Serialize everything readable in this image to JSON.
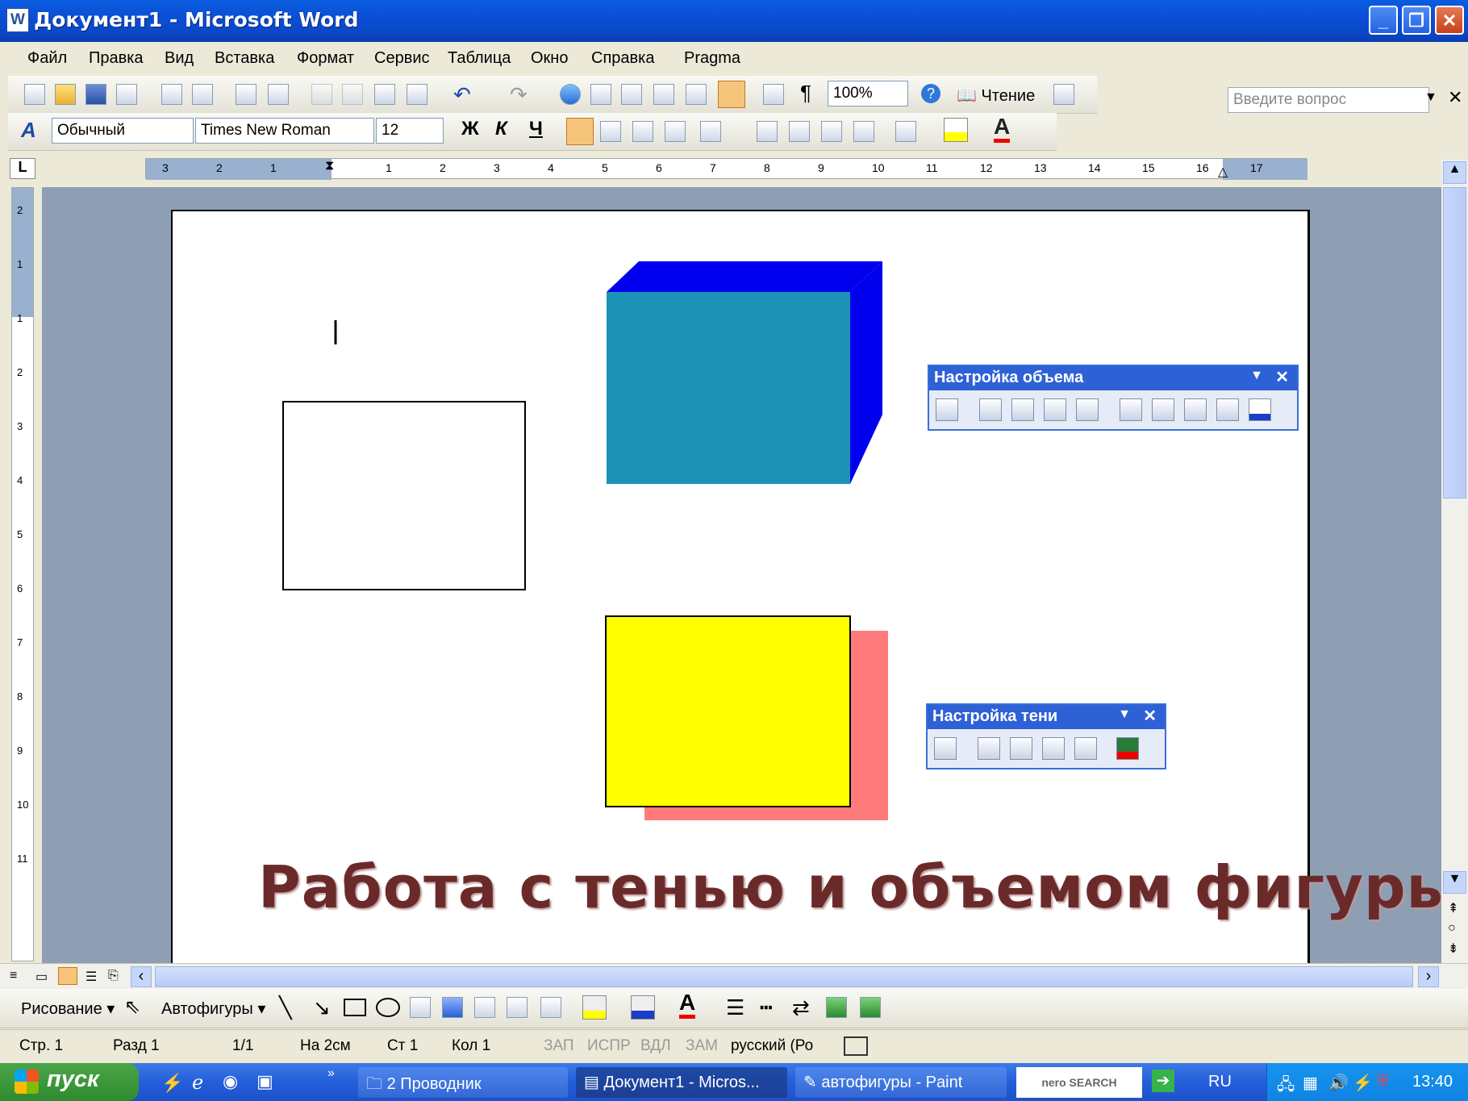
{
  "window": {
    "title": "Документ1 - Microsoft Word"
  },
  "menu": {
    "items": [
      "Файл",
      "Правка",
      "Вид",
      "Вставка",
      "Формат",
      "Сервис",
      "Таблица",
      "Окно",
      "Справка",
      "Pragma"
    ],
    "help_placeholder": "Введите вопрос"
  },
  "standard_toolbar": {
    "zoom": "100%",
    "reading_label": "Чтение"
  },
  "formatting_toolbar": {
    "style": "Обычный",
    "font": "Times New Roman",
    "size": "12",
    "bold": "Ж",
    "italic": "К",
    "underline": "Ч"
  },
  "ruler": {
    "labels": [
      "3",
      "2",
      "1",
      "1",
      "2",
      "3",
      "4",
      "5",
      "6",
      "7",
      "8",
      "9",
      "10",
      "11",
      "12",
      "13",
      "14",
      "15",
      "16",
      "17"
    ]
  },
  "vruler": {
    "labels": [
      "2",
      "1",
      "1",
      "2",
      "3",
      "4",
      "5",
      "6",
      "7",
      "8",
      "9",
      "10",
      "11"
    ]
  },
  "document": {
    "caption": "Работа с тенью и объемом фигуры",
    "colors": {
      "cube_front": "#1b92b6",
      "cube_side": "#0000ee",
      "yellow": "#ffff00",
      "shadow": "#ff7b7b"
    }
  },
  "palette_3d": {
    "title": "Настройка объема"
  },
  "palette_shadow": {
    "title": "Настройка тени"
  },
  "drawing_toolbar": {
    "drawing_label": "Рисование",
    "autoshapes_label": "Автофигуры"
  },
  "statusbar": {
    "page": "Стр. 1",
    "section": "Разд 1",
    "pages": "1/1",
    "at": "На 2см",
    "line": "Ст 1",
    "col": "Кол 1",
    "rec": "ЗАП",
    "trk": "ИСПР",
    "ext": "ВДЛ",
    "ovr": "ЗАМ",
    "lang": "русский (Ро"
  },
  "taskbar": {
    "start": "пуск",
    "tasks": [
      "2 Проводник",
      "Документ1 - Micros...",
      "автофигуры - Paint"
    ],
    "nero": "nero SEARCH",
    "lang": "RU",
    "clock": "13:40"
  }
}
